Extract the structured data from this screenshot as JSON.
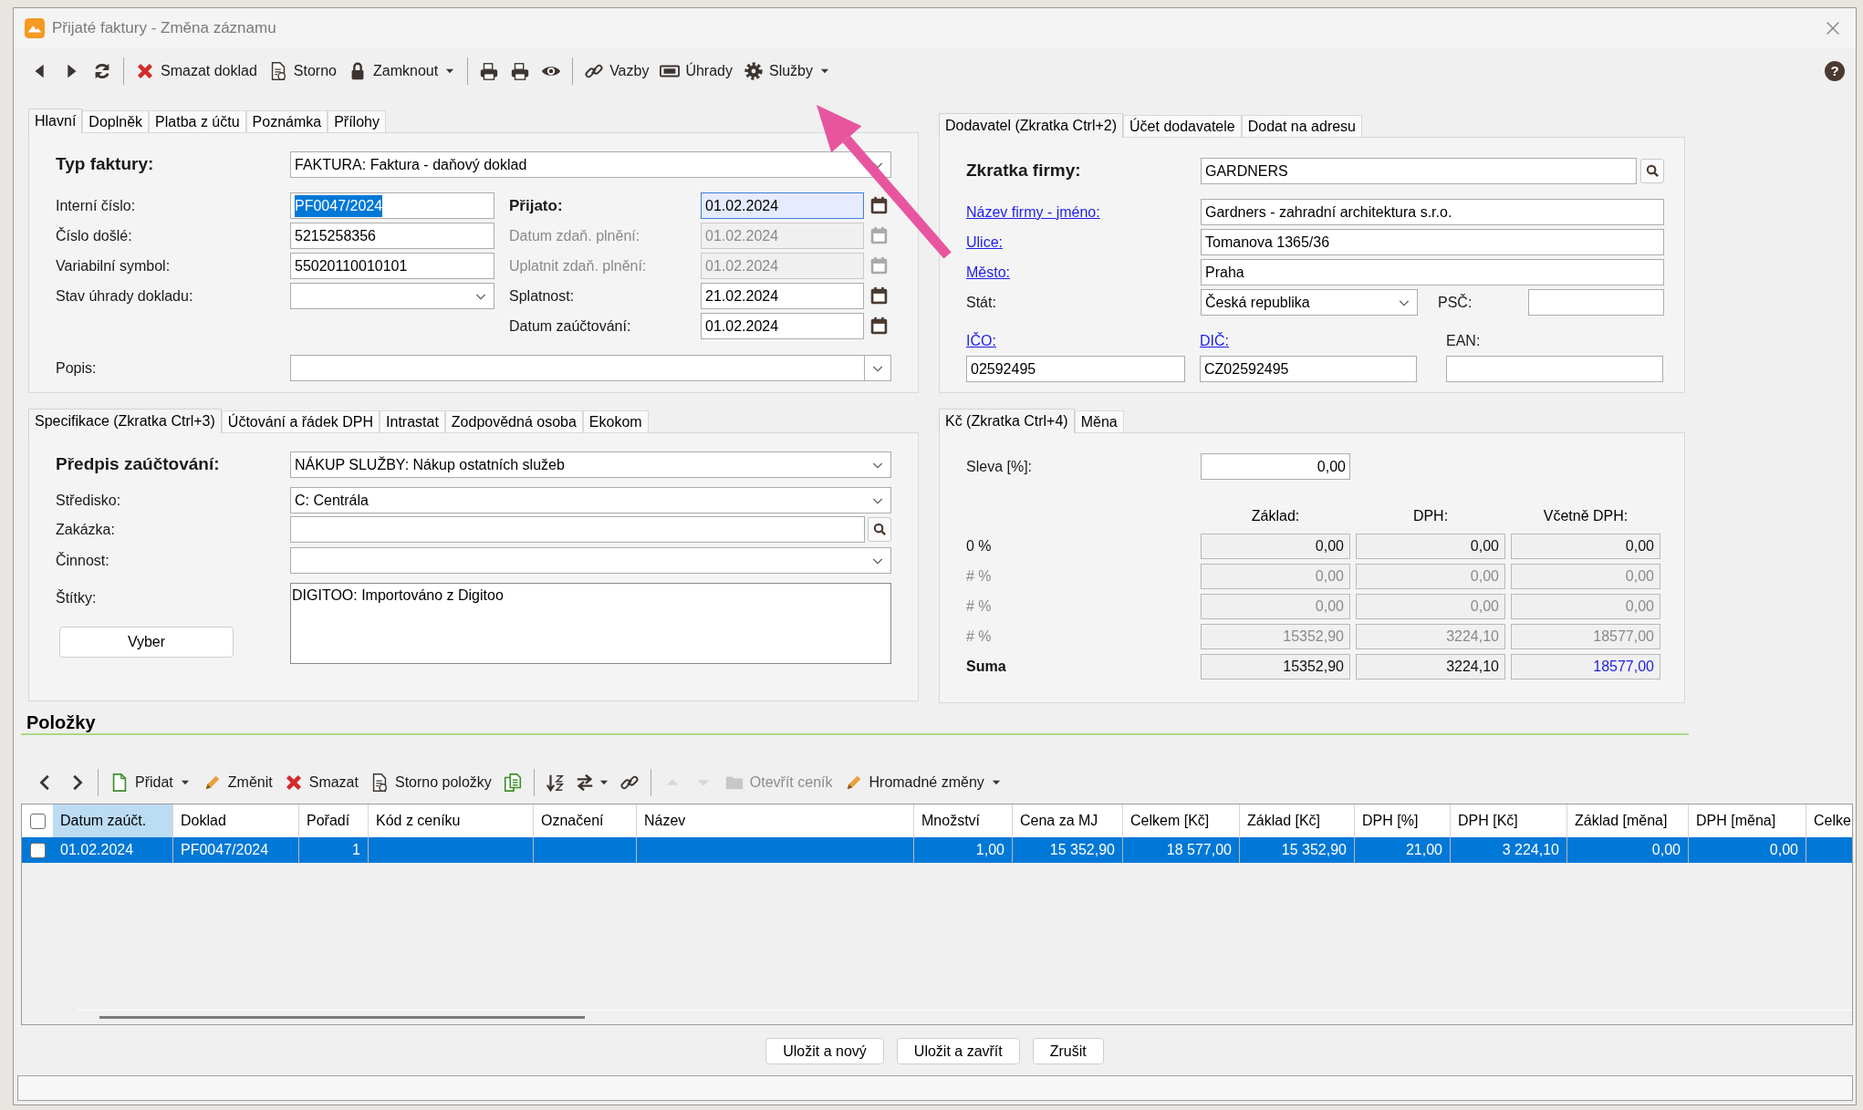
{
  "window": {
    "title": "Přijaté faktury - Změna záznamu",
    "help": "?"
  },
  "toolbar": [
    {
      "kind": "icon"
    },
    {
      "kind": "icon"
    },
    {
      "kind": "icon"
    },
    {
      "kind": "separator"
    },
    {
      "kind": "button",
      "label": "Smazat doklad",
      "dropdown": false
    },
    {
      "kind": "button",
      "label": "Storno",
      "dropdown": false
    },
    {
      "kind": "button",
      "label": "Zamknout",
      "dropdown": true
    },
    {
      "kind": "separator"
    },
    {
      "kind": "icon"
    },
    {
      "kind": "icon"
    },
    {
      "kind": "icon"
    },
    {
      "kind": "separator"
    },
    {
      "kind": "button",
      "label": "Vazby",
      "dropdown": false
    },
    {
      "kind": "button",
      "label": "Úhrady",
      "dropdown": false
    },
    {
      "kind": "button",
      "label": "Služby",
      "dropdown": true
    }
  ],
  "main_tabs": [
    {
      "label": "Hlavní",
      "selected": true
    },
    {
      "label": "Doplněk",
      "selected": false
    },
    {
      "label": "Platba z účtu",
      "selected": false
    },
    {
      "label": "Poznámka",
      "selected": false
    },
    {
      "label": "Přílohy",
      "selected": false
    }
  ],
  "invoice": {
    "type": {
      "label": "Typ faktury:",
      "value": "FAKTURA: Faktura - daňový doklad"
    },
    "fields": [
      {
        "kind": "text",
        "label": "Interní číslo:",
        "value": "PF0047/2024",
        "text_selected": true
      },
      {
        "kind": "text",
        "label": "Číslo došlé:",
        "value": "5215258356",
        "text_selected": false
      },
      {
        "kind": "text",
        "label": "Variabilní symbol:",
        "value": "55020110010101",
        "text_selected": false
      },
      {
        "kind": "select",
        "label": "Stav úhrady dokladu:"
      }
    ],
    "dates": [
      {
        "label": "Přijato:",
        "value": "01.02.2024",
        "bold": true,
        "focused": true,
        "disabled": false
      },
      {
        "label": "Datum zdaň. plnění:",
        "value": "01.02.2024",
        "bold": false,
        "focused": false,
        "disabled": true
      },
      {
        "label": "Uplatnit zdaň. plnění:",
        "value": "01.02.2024",
        "bold": false,
        "focused": false,
        "disabled": true
      },
      {
        "label": "Splatnost:",
        "value": "21.02.2024",
        "bold": false,
        "focused": false,
        "disabled": false
      },
      {
        "label": "Datum zaúčtování:",
        "value": "01.02.2024",
        "bold": false,
        "focused": false,
        "disabled": false
      }
    ],
    "description": {
      "label": "Popis:"
    }
  },
  "supplier_tabs": [
    {
      "label": "Dodavatel (Zkratka Ctrl+2)",
      "selected": true
    },
    {
      "label": "Účet dodavatele",
      "selected": false
    },
    {
      "label": "Dodat na adresu",
      "selected": false
    }
  ],
  "supplier": {
    "short_name": {
      "label": "Zkratka firmy:",
      "value": "GARDNERS"
    },
    "address": [
      {
        "label": "Název firmy - jméno:",
        "value": "Gardners - zahradní architektura s.r.o.",
        "link": true
      },
      {
        "label": "Ulice:",
        "value": "Tomanova 1365/36",
        "link": true
      },
      {
        "label": "Město:",
        "value": "Praha",
        "link": true
      }
    ],
    "country": {
      "label": "Stát:",
      "value": "Česká republika"
    },
    "zip": {
      "label": "PSČ:"
    },
    "ids": [
      {
        "label": "IČO:",
        "value": "02592495",
        "link": true
      },
      {
        "label": "DIČ:",
        "value": "CZ02592495",
        "link": true
      },
      {
        "label": "EAN:",
        "link": false
      }
    ]
  },
  "spec_tabs": [
    {
      "label": "Specifikace (Zkratka Ctrl+3)",
      "selected": true
    },
    {
      "label": "Účtování a řádek DPH",
      "selected": false
    },
    {
      "label": "Intrastat",
      "selected": false
    },
    {
      "label": "Zodpovědná osoba",
      "selected": false
    },
    {
      "label": "Ekokom",
      "selected": false
    }
  ],
  "spec": {
    "posting": {
      "label": "Předpis zaúčtování:",
      "value": "NÁKUP SLUŽBY: Nákup ostatních služeb"
    },
    "centre": {
      "label": "Středisko:",
      "value": "C: Centrála"
    },
    "order": {
      "label": "Zakázka:"
    },
    "activity": {
      "label": "Činnost:"
    },
    "tags": {
      "label": "Štítky:",
      "value": "DIGITOO: Importováno z Digitoo",
      "button": "Vyber"
    }
  },
  "amount_tabs": [
    {
      "label": "Kč (Zkratka Ctrl+4)",
      "selected": true
    },
    {
      "label": "Měna",
      "selected": false
    }
  ],
  "amounts": {
    "discount": {
      "label": "Sleva [%]:",
      "value": "0,00"
    },
    "columns": [
      "Základ:",
      "DPH:",
      "Včetně DPH:"
    ],
    "rows": [
      {
        "label": "0 %",
        "muted": false,
        "total": false,
        "values": [
          "0,00",
          "0,00",
          "0,00"
        ]
      },
      {
        "label": "# %",
        "muted": true,
        "total": false,
        "values": [
          "0,00",
          "0,00",
          "0,00"
        ]
      },
      {
        "label": "# %",
        "muted": true,
        "total": false,
        "values": [
          "0,00",
          "0,00",
          "0,00"
        ]
      },
      {
        "label": "# %",
        "muted": true,
        "total": false,
        "values": [
          "15352,90",
          "3224,10",
          "18577,00"
        ]
      },
      {
        "label": "Suma",
        "muted": false,
        "total": true,
        "values": [
          "15352,90",
          "3224,10",
          "18577,00"
        ]
      }
    ]
  },
  "items": {
    "title": "Položky",
    "toolbar": [
      {
        "kind": "icon",
        "disabled": false
      },
      {
        "kind": "icon",
        "disabled": false
      },
      {
        "kind": "separator"
      },
      {
        "kind": "button",
        "label": "Přidat",
        "dropdown": true,
        "disabled": false
      },
      {
        "kind": "button",
        "label": "Změnit",
        "dropdown": false,
        "disabled": false
      },
      {
        "kind": "button",
        "label": "Smazat",
        "dropdown": false,
        "disabled": false
      },
      {
        "kind": "button",
        "label": "Storno položky",
        "dropdown": false,
        "disabled": false
      },
      {
        "kind": "icon",
        "disabled": false
      },
      {
        "kind": "separator"
      },
      {
        "kind": "icon",
        "disabled": false
      },
      {
        "kind": "icon",
        "dropdown": true,
        "disabled": false
      },
      {
        "kind": "icon",
        "disabled": false
      },
      {
        "kind": "separator"
      },
      {
        "kind": "icon",
        "disabled": true
      },
      {
        "kind": "icon",
        "disabled": true
      },
      {
        "kind": "button",
        "label": "Otevřít ceník",
        "dropdown": false,
        "disabled": true
      },
      {
        "kind": "button",
        "label": "Hromadné změny",
        "dropdown": true,
        "disabled": false
      }
    ],
    "all_checked": false,
    "columns": [
      {
        "label": "Datum zaúčt.",
        "kind": "text",
        "selected": true
      },
      {
        "label": "Doklad",
        "kind": "text",
        "selected": false
      },
      {
        "label": "Pořadí",
        "kind": "number",
        "selected": false
      },
      {
        "label": "Kód z ceníku",
        "kind": "text",
        "selected": false
      },
      {
        "label": "Označení",
        "kind": "text",
        "selected": false
      },
      {
        "label": "Název",
        "kind": "text",
        "selected": false
      },
      {
        "label": "Množství",
        "kind": "number",
        "selected": false
      },
      {
        "label": "Cena za MJ",
        "kind": "number",
        "selected": false
      },
      {
        "label": "Celkem [Kč]",
        "kind": "number",
        "selected": false
      },
      {
        "label": "Základ [Kč]",
        "kind": "number",
        "selected": false
      },
      {
        "label": "DPH [%]",
        "kind": "number",
        "selected": false
      },
      {
        "label": "DPH [Kč]",
        "kind": "number",
        "selected": false
      },
      {
        "label": "Základ [měna]",
        "kind": "number",
        "selected": false
      },
      {
        "label": "DPH [měna]",
        "kind": "number",
        "selected": false
      },
      {
        "label": "Celke",
        "kind": "number",
        "selected": false
      }
    ],
    "rows": [
      {
        "selected": true,
        "checked": false,
        "cells": [
          "01.02.2024",
          "PF0047/2024",
          "1",
          null,
          null,
          null,
          "1,00",
          "15 352,90",
          "18 577,00",
          "15 352,90",
          "21,00",
          "3 224,10",
          "0,00",
          "0,00",
          null
        ]
      }
    ]
  },
  "buttons": [
    "Uložit a nový",
    "Uložit a zavřít",
    "Zrušit"
  ]
}
